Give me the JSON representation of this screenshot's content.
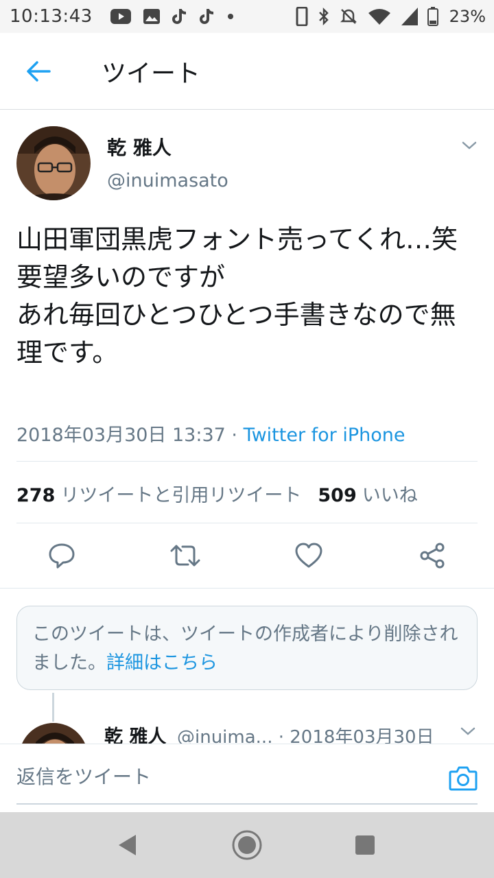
{
  "status_bar": {
    "time": "10:13:43",
    "battery": "23%"
  },
  "header": {
    "title": "ツイート"
  },
  "tweet": {
    "author_name": "乾 雅人",
    "author_handle": "@inuimasato",
    "text": "山田軍団黒虎フォント売ってくれ…笑\n要望多いのですが\nあれ毎回ひとつひとつ手書きなので無理です。",
    "date": "2018年03月30日 13:37",
    "separator": " · ",
    "source": "Twitter for iPhone",
    "retweets_count": "278",
    "retweets_label": "リツイートと引用リツイート",
    "likes_count": "509",
    "likes_label": "いいね"
  },
  "deleted_notice": {
    "text": "このツイートは、ツイートの作成者により削除されました。",
    "link": "詳細はこちら"
  },
  "reply_preview": {
    "author_name": "乾 雅人",
    "author_handle": "@inuima...",
    "date": " · 2018年03月30日"
  },
  "composer": {
    "placeholder": "返信をツイート"
  },
  "colors": {
    "accent": "#1da1f2",
    "link": "#1b95e0",
    "secondary_text": "#657786"
  }
}
